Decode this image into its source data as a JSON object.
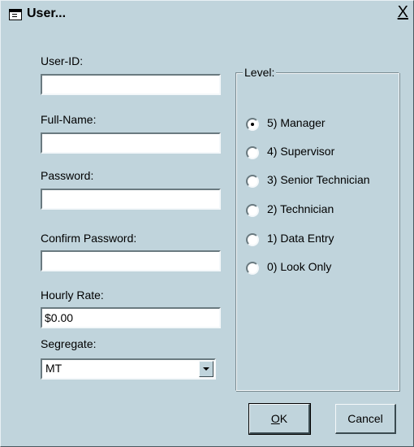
{
  "window": {
    "title": "User...",
    "close_glyph": "X"
  },
  "form": {
    "user_id": {
      "label": "User-ID:",
      "value": ""
    },
    "full_name": {
      "label": "Full-Name:",
      "value": ""
    },
    "password": {
      "label": "Password:",
      "value": ""
    },
    "confirm_password": {
      "label": "Confirm Password:",
      "value": ""
    },
    "hourly_rate": {
      "label": "Hourly Rate:",
      "value": "$0.00"
    },
    "segregate": {
      "label": "Segregate:",
      "value": "MT"
    }
  },
  "level": {
    "legend": "Level:",
    "selected": 0,
    "options": [
      "5) Manager",
      "4) Supervisor",
      "3) Senior Technician",
      "2) Technician",
      "1) Data Entry",
      "0) Look Only"
    ]
  },
  "buttons": {
    "ok_accel": "O",
    "ok_rest": "K",
    "cancel": "Cancel"
  },
  "colors": {
    "dialog_bg": "#c0d4dc"
  }
}
